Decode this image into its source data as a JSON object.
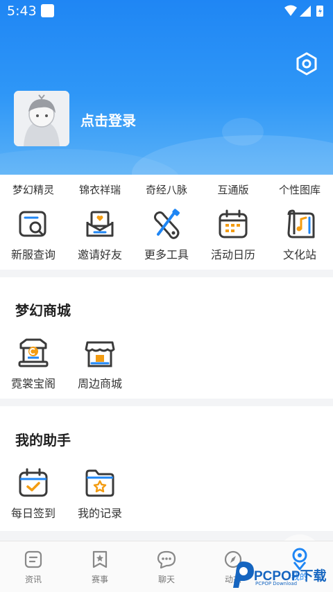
{
  "status": {
    "time": "5:43"
  },
  "header": {
    "login_text": "点击登录"
  },
  "top_row": [
    "梦幻精灵",
    "锦衣祥瑞",
    "奇经八脉",
    "互通版",
    "个性图库"
  ],
  "tools": [
    {
      "label": "新服查询",
      "icon": "server-search-icon"
    },
    {
      "label": "邀请好友",
      "icon": "invite-mail-icon"
    },
    {
      "label": "更多工具",
      "icon": "tools-icon"
    },
    {
      "label": "活动日历",
      "icon": "calendar-icon"
    },
    {
      "label": "文化站",
      "icon": "music-scroll-icon"
    }
  ],
  "mall": {
    "title": "梦幻商城",
    "items": [
      {
        "label": "霓裳宝阁",
        "icon": "treasure-pavilion-icon"
      },
      {
        "label": "周边商城",
        "icon": "shop-icon"
      }
    ]
  },
  "assistant": {
    "title": "我的助手",
    "items": [
      {
        "label": "每日签到",
        "icon": "checkin-calendar-icon"
      },
      {
        "label": "我的记录",
        "icon": "record-folder-icon"
      }
    ]
  },
  "tabbar": [
    {
      "label": "资讯",
      "icon": "news-icon"
    },
    {
      "label": "赛事",
      "icon": "event-icon"
    },
    {
      "label": "聊天",
      "icon": "chat-icon"
    },
    {
      "label": "动态",
      "icon": "compass-icon"
    },
    {
      "label": "我的",
      "icon": "profile-icon",
      "active": true
    }
  ],
  "watermark": {
    "text": "PCPOP下载",
    "sub": "PCPOP Download"
  },
  "colors": {
    "primary": "#1f86f4",
    "accent": "#f39c12",
    "icon_dark": "#3a3a3a"
  }
}
